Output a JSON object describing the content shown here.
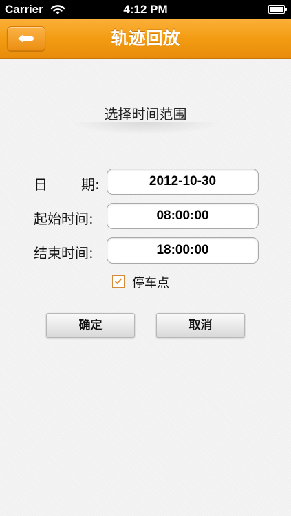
{
  "status_bar": {
    "carrier": "Carrier",
    "time": "4:12 PM"
  },
  "nav": {
    "title": "轨迹回放",
    "back_icon": "back-arrow-icon"
  },
  "section_title": "选择时间范围",
  "form": {
    "date_label_char1": "日",
    "date_label_char2": "期:",
    "date_value": "2012-10-30",
    "start_label": "起始时间:",
    "start_value": "08:00:00",
    "end_label": "结束时间:",
    "end_value": "18:00:00",
    "stop_point_label": "停车点",
    "stop_point_checked": true
  },
  "buttons": {
    "confirm": "确定",
    "cancel": "取消"
  },
  "colors": {
    "nav_orange": "#f39c12",
    "checkbox_orange": "#d58a3a"
  }
}
